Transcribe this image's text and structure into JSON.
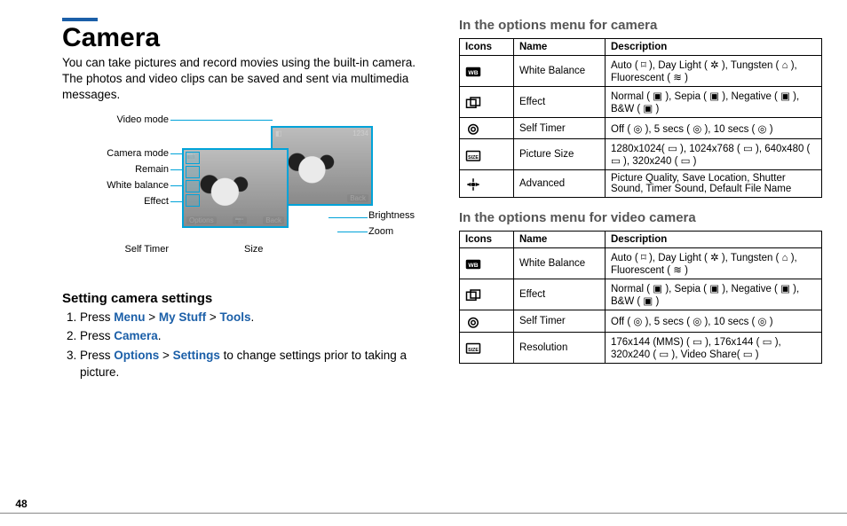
{
  "pageNumber": "48",
  "left": {
    "title": "Camera",
    "intro": "You can take pictures and record movies using the built-in camera. The photos and video clips can be saved and sent via multimedia messages.",
    "settingsHeading": "Setting camera settings",
    "steps": {
      "s1a": "Press ",
      "s1b": "Menu",
      "s1c": " > ",
      "s1d": "My Stuff",
      "s1e": " > ",
      "s1f": "Tools",
      "s1g": ".",
      "s2a": "Press ",
      "s2b": "Camera",
      "s2c": ".",
      "s3a": "Press ",
      "s3b": "Options",
      "s3c": " > ",
      "s3d": "Settings",
      "s3e": " to change settings prior to taking a picture."
    },
    "labels": {
      "videoMode": "Video mode",
      "cameraMode": "Camera mode",
      "remain": "Remain",
      "whiteBalance": "White balance",
      "effect": "Effect",
      "selfTimer": "Self Timer",
      "size": "Size",
      "brightness": "Brightness",
      "zoom": "Zoom",
      "options": "Options",
      "back": "Back",
      "remainCount": "1234"
    }
  },
  "right": {
    "cameraHeading": "In the options menu for camera",
    "videoHeading": "In the options menu for video camera",
    "headers": {
      "icons": "Icons",
      "name": "Name",
      "desc": "Description"
    },
    "camRows": [
      {
        "name": "White Balance",
        "desc": "Auto ( ⌑ ), Day Light ( ✲ ), Tungsten ( ⌂ ), Fluorescent ( ≋ )"
      },
      {
        "name": "Effect",
        "desc": "Normal ( ▣ ), Sepia ( ▣ ), Negative ( ▣ ), B&W ( ▣ )"
      },
      {
        "name": "Self Timer",
        "desc": "Off ( ◎ ), 5 secs ( ◎ ), 10 secs ( ◎ )"
      },
      {
        "name": "Picture Size",
        "desc": "1280x1024( ▭ ), 1024x768 ( ▭ ), 640x480 ( ▭ ), 320x240 ( ▭ )"
      },
      {
        "name": "Advanced",
        "desc": "Picture Quality, Save Location, Shutter Sound, Timer Sound, Default File Name"
      }
    ],
    "vidRows": [
      {
        "name": "White Balance",
        "desc": "Auto ( ⌑ ), Day Light ( ✲ ), Tungsten ( ⌂ ), Fluorescent ( ≋ )"
      },
      {
        "name": "Effect",
        "desc": "Normal ( ▣ ), Sepia ( ▣ ), Negative ( ▣ ), B&W ( ▣ )"
      },
      {
        "name": "Self Timer",
        "desc": "Off ( ◎ ), 5 secs ( ◎ ), 10 secs ( ◎ )"
      },
      {
        "name": "Resolution",
        "desc": "176x144 (MMS) ( ▭ ), 176x144 ( ▭ ), 320x240 ( ▭ ), Video Share( ▭ )"
      }
    ]
  }
}
